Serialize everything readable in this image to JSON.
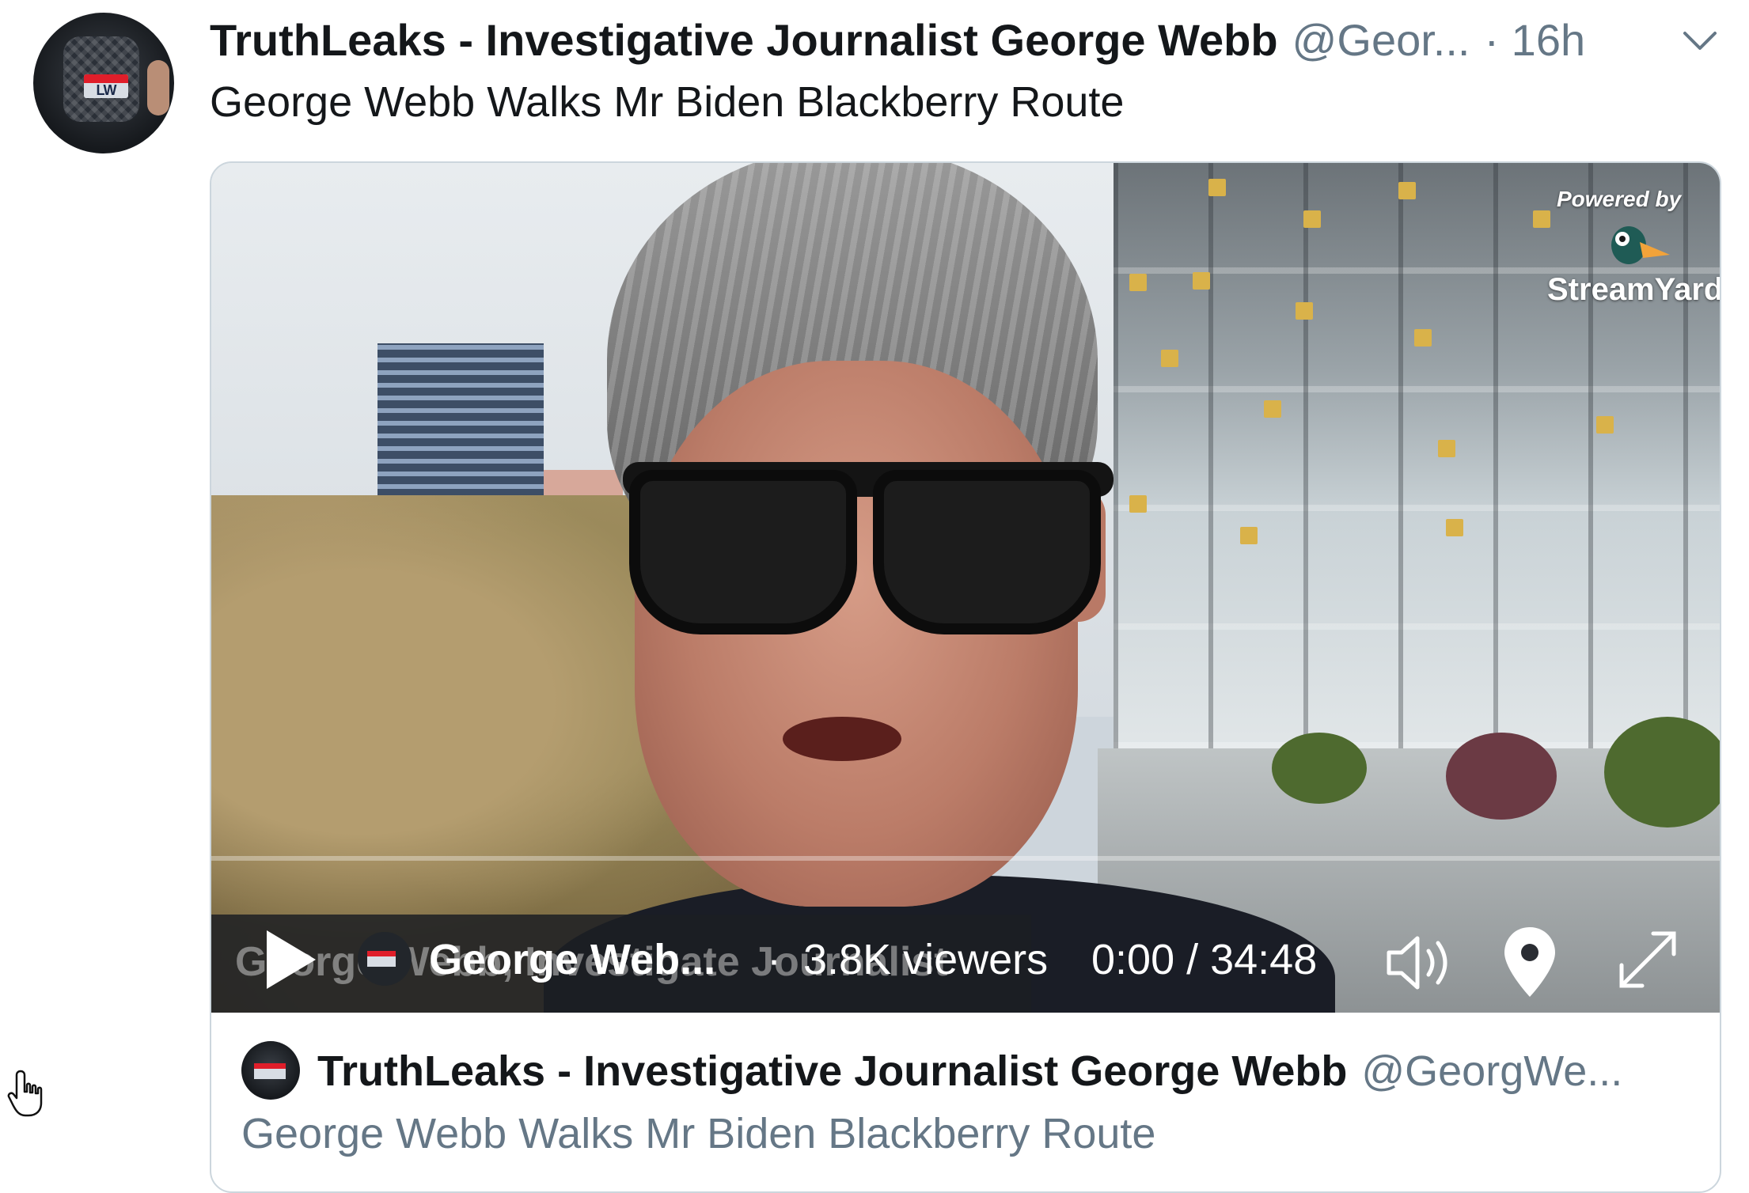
{
  "tweet": {
    "display_name": "TruthLeaks - Investigative Journalist George Webb",
    "handle": "@Geor...",
    "timestamp": "· 16h",
    "text": "George Webb Walks Mr Biden Blackberry Route",
    "avatar_logo_text": "LW"
  },
  "video": {
    "powered_by": "Powered by",
    "brand": "StreamYard",
    "under_caption": "George Webb, Investigate Journalist",
    "progress_fraction": 0,
    "controls": {
      "play_icon": "play-icon",
      "broadcaster": "George Web...",
      "separator": "·",
      "viewers": "3.8K viewers",
      "time": "0:00 / 34:48",
      "volume_icon": "volume-icon",
      "location_icon": "location-pin-icon",
      "fullscreen_icon": "fullscreen-icon"
    }
  },
  "card": {
    "display_name": "TruthLeaks - Investigative Journalist George Webb",
    "handle": "@GeorgWe...",
    "title": "George Webb Walks Mr Biden Blackberry Route"
  },
  "colors": {
    "text_primary": "#14171a",
    "text_secondary": "#657786",
    "border": "#ccd6dd",
    "logo_red": "#e01e2a"
  }
}
